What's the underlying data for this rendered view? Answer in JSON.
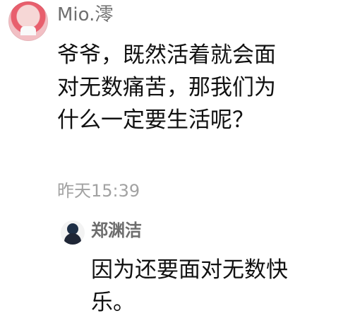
{
  "post": {
    "username": "Mio.澪",
    "text": "爷爷，既然活着就会面对无数痛苦，那我们为什么一定要生活呢？",
    "timestamp": "昨天15:39",
    "avatar_icon": "user-avatar-icon"
  },
  "reply": {
    "username": "郑渊洁",
    "text": "因为还要面对无数快乐。",
    "avatar_icon": "reply-avatar-icon"
  },
  "colors": {
    "background": "#ffffff",
    "primary_text": "#111111",
    "username": "#6f6f6f",
    "timestamp": "#a2a2a2"
  }
}
